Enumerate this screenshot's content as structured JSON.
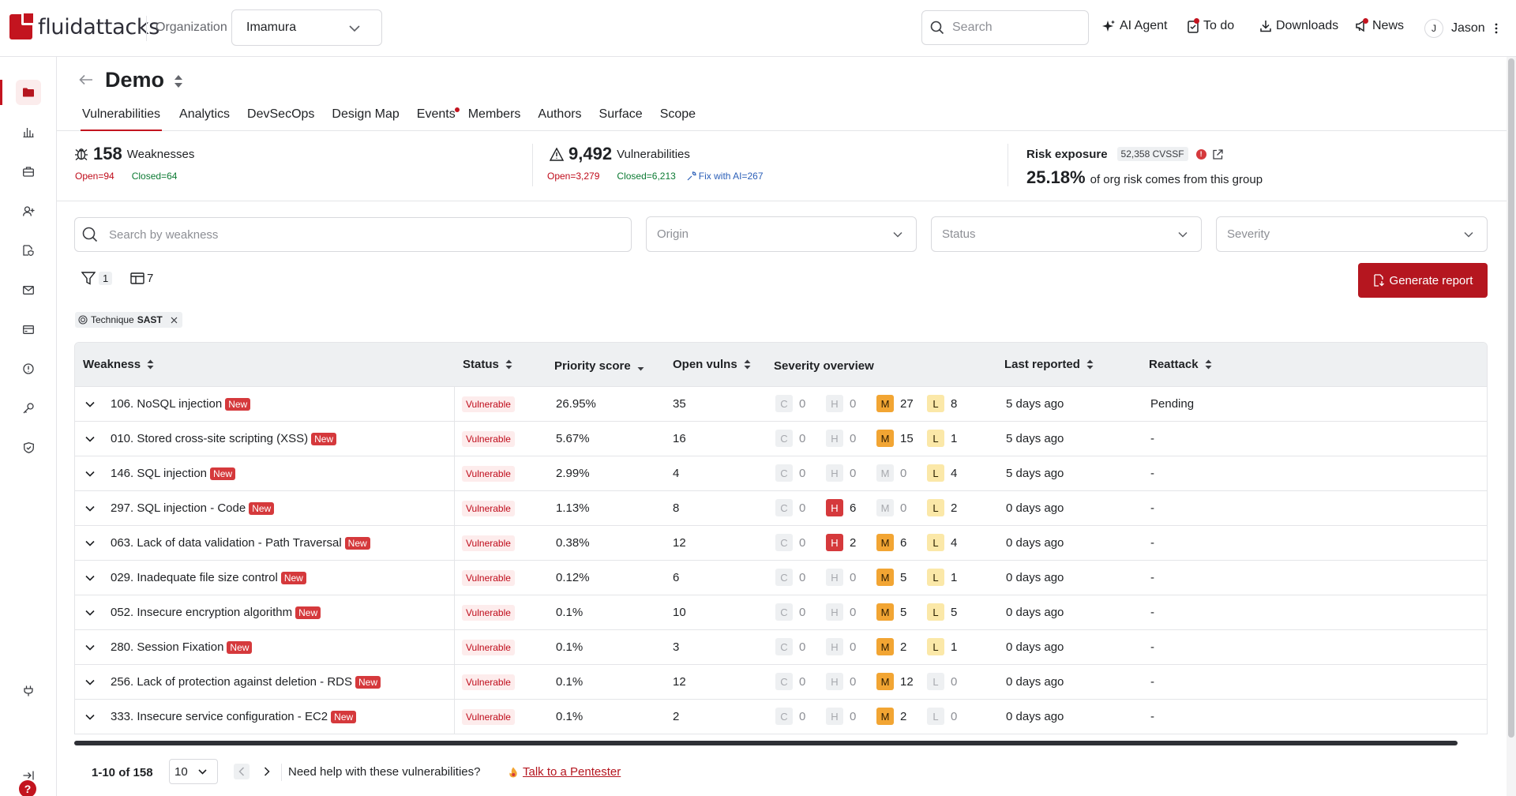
{
  "app": {
    "logo_text": "fluidattacks",
    "org_label": "Organization",
    "org_value": "Imamura"
  },
  "topnav": {
    "search_placeholder": "Search",
    "ai_agent": "AI Agent",
    "todo": "To do",
    "downloads": "Downloads",
    "news": "News",
    "user_initial": "J",
    "user_name": "Jason"
  },
  "group": {
    "title": "Demo"
  },
  "tabs": [
    "Vulnerabilities",
    "Analytics",
    "DevSecOps",
    "Design Map",
    "Events",
    "Members",
    "Authors",
    "Surface",
    "Scope"
  ],
  "stats": {
    "weaknesses": {
      "count": "158",
      "label": "Weaknesses",
      "open": "Open=94",
      "closed": "Closed=64"
    },
    "vulnerabilities": {
      "count": "9,492",
      "label": "Vulnerabilities",
      "open": "Open=3,279",
      "closed": "Closed=6,213",
      "fix_ai": "Fix with AI=267"
    },
    "risk": {
      "label": "Risk exposure",
      "cvssf": "52,358 CVSSF",
      "percent": "25.18%",
      "desc": "of org risk comes from this group"
    }
  },
  "filters": {
    "search_placeholder": "Search by weakness",
    "origin": "Origin",
    "status": "Status",
    "severity": "Severity",
    "filter_count": "1",
    "columns_count": "7",
    "generate_report": "Generate report",
    "chip_label": "Technique",
    "chip_value": "SAST"
  },
  "table": {
    "headers": {
      "weakness": "Weakness",
      "status": "Status",
      "priority": "Priority score",
      "open": "Open vulns",
      "severity": "Severity overview",
      "last": "Last reported",
      "reattack": "Reattack"
    },
    "new_label": "New",
    "rows": [
      {
        "name": "106. NoSQL injection",
        "status": "Vulnerable",
        "priority": "26.95%",
        "open": "35",
        "c": "0",
        "h": "0",
        "m": "27",
        "l": "8",
        "last": "5 days ago",
        "reattack": "Pending"
      },
      {
        "name": "010. Stored cross-site scripting (XSS)",
        "status": "Vulnerable",
        "priority": "5.67%",
        "open": "16",
        "c": "0",
        "h": "0",
        "m": "15",
        "l": "1",
        "last": "5 days ago",
        "reattack": "-"
      },
      {
        "name": "146. SQL injection",
        "status": "Vulnerable",
        "priority": "2.99%",
        "open": "4",
        "c": "0",
        "h": "0",
        "m": "0",
        "l": "4",
        "last": "5 days ago",
        "reattack": "-"
      },
      {
        "name": "297. SQL injection - Code",
        "status": "Vulnerable",
        "priority": "1.13%",
        "open": "8",
        "c": "0",
        "h": "6",
        "m": "0",
        "l": "2",
        "last": "0 days ago",
        "reattack": "-"
      },
      {
        "name": "063. Lack of data validation - Path Traversal",
        "status": "Vulnerable",
        "priority": "0.38%",
        "open": "12",
        "c": "0",
        "h": "2",
        "m": "6",
        "l": "4",
        "last": "0 days ago",
        "reattack": "-"
      },
      {
        "name": "029. Inadequate file size control",
        "status": "Vulnerable",
        "priority": "0.12%",
        "open": "6",
        "c": "0",
        "h": "0",
        "m": "5",
        "l": "1",
        "last": "0 days ago",
        "reattack": "-"
      },
      {
        "name": "052. Insecure encryption algorithm",
        "status": "Vulnerable",
        "priority": "0.1%",
        "open": "10",
        "c": "0",
        "h": "0",
        "m": "5",
        "l": "5",
        "last": "0 days ago",
        "reattack": "-"
      },
      {
        "name": "280. Session Fixation",
        "status": "Vulnerable",
        "priority": "0.1%",
        "open": "3",
        "c": "0",
        "h": "0",
        "m": "2",
        "l": "1",
        "last": "0 days ago",
        "reattack": "-"
      },
      {
        "name": "256. Lack of protection against deletion - RDS",
        "status": "Vulnerable",
        "priority": "0.1%",
        "open": "12",
        "c": "0",
        "h": "0",
        "m": "12",
        "l": "0",
        "last": "0 days ago",
        "reattack": "-"
      },
      {
        "name": "333. Insecure service configuration - EC2",
        "status": "Vulnerable",
        "priority": "0.1%",
        "open": "2",
        "c": "0",
        "h": "0",
        "m": "2",
        "l": "0",
        "last": "0 days ago",
        "reattack": "-"
      }
    ]
  },
  "pagination": {
    "range": "1-10 of 158",
    "page_size": "10",
    "help": "Need help with these vulnerabilities?",
    "talk": "Talk to a Pentester"
  },
  "colors": {
    "brand": "#c3141f",
    "open": "#bf0b1a",
    "closed": "#0c7a33",
    "high": "#d5393c",
    "medium": "#f2a533",
    "low": "#fbe8a8"
  }
}
